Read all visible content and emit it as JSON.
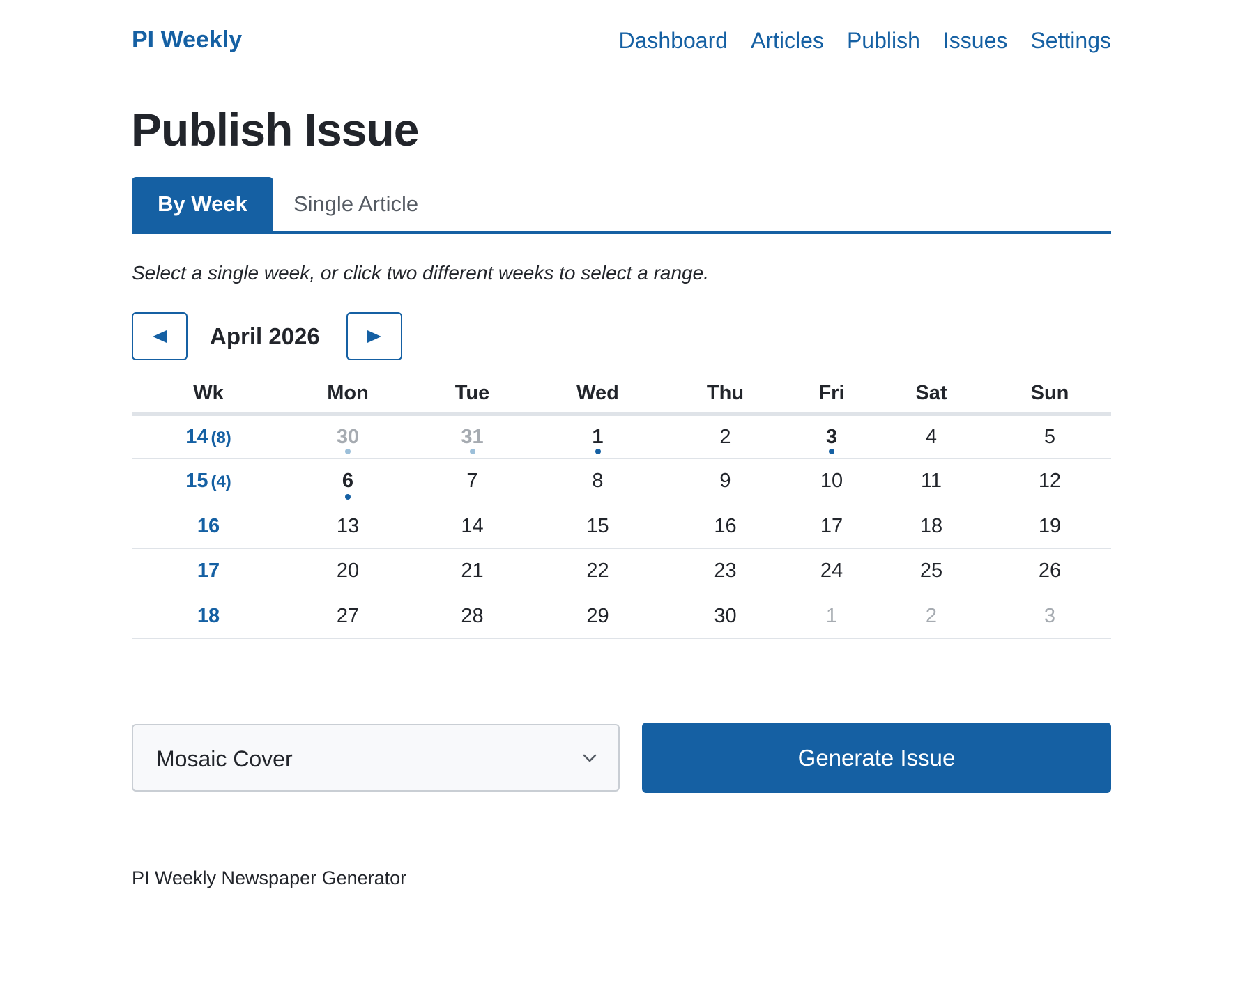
{
  "header": {
    "brand": "PI Weekly",
    "nav": [
      "Dashboard",
      "Articles",
      "Publish",
      "Issues",
      "Settings"
    ]
  },
  "page_title": "Publish Issue",
  "tabs": [
    {
      "label": "By Week",
      "active": true
    },
    {
      "label": "Single Article",
      "active": false
    }
  ],
  "hint": "Select a single week, or click two different weeks to select a range.",
  "calendar": {
    "month_label": "April 2026",
    "prev_icon": "triangle-left-icon",
    "next_icon": "triangle-right-icon",
    "headers": [
      "Wk",
      "Mon",
      "Tue",
      "Wed",
      "Thu",
      "Fri",
      "Sat",
      "Sun"
    ],
    "weeks": [
      {
        "week": "14",
        "count": "(8)",
        "days": [
          {
            "d": "30",
            "muted": true,
            "bold": true,
            "dot": "light"
          },
          {
            "d": "31",
            "muted": true,
            "bold": true,
            "dot": "light"
          },
          {
            "d": "1",
            "bold": true,
            "dot": "dark"
          },
          {
            "d": "2"
          },
          {
            "d": "3",
            "bold": true,
            "dot": "dark"
          },
          {
            "d": "4"
          },
          {
            "d": "5"
          }
        ]
      },
      {
        "week": "15",
        "count": "(4)",
        "days": [
          {
            "d": "6",
            "bold": true,
            "dot": "dark"
          },
          {
            "d": "7"
          },
          {
            "d": "8"
          },
          {
            "d": "9"
          },
          {
            "d": "10"
          },
          {
            "d": "11"
          },
          {
            "d": "12"
          }
        ]
      },
      {
        "week": "16",
        "count": "",
        "days": [
          {
            "d": "13"
          },
          {
            "d": "14"
          },
          {
            "d": "15"
          },
          {
            "d": "16"
          },
          {
            "d": "17"
          },
          {
            "d": "18"
          },
          {
            "d": "19"
          }
        ]
      },
      {
        "week": "17",
        "count": "",
        "days": [
          {
            "d": "20"
          },
          {
            "d": "21"
          },
          {
            "d": "22"
          },
          {
            "d": "23"
          },
          {
            "d": "24"
          },
          {
            "d": "25"
          },
          {
            "d": "26"
          }
        ]
      },
      {
        "week": "18",
        "count": "",
        "days": [
          {
            "d": "27"
          },
          {
            "d": "28"
          },
          {
            "d": "29"
          },
          {
            "d": "30"
          },
          {
            "d": "1",
            "muted": true
          },
          {
            "d": "2",
            "muted": true
          },
          {
            "d": "3",
            "muted": true
          }
        ]
      }
    ]
  },
  "cover_select": {
    "value": "Mosaic Cover",
    "icon": "chevron-down-icon"
  },
  "generate_label": "Generate Issue",
  "footer": "PI Weekly Newspaper Generator",
  "colors": {
    "accent": "#1560a3",
    "muted_text": "#a6abb1",
    "border": "#dfe3e8"
  }
}
